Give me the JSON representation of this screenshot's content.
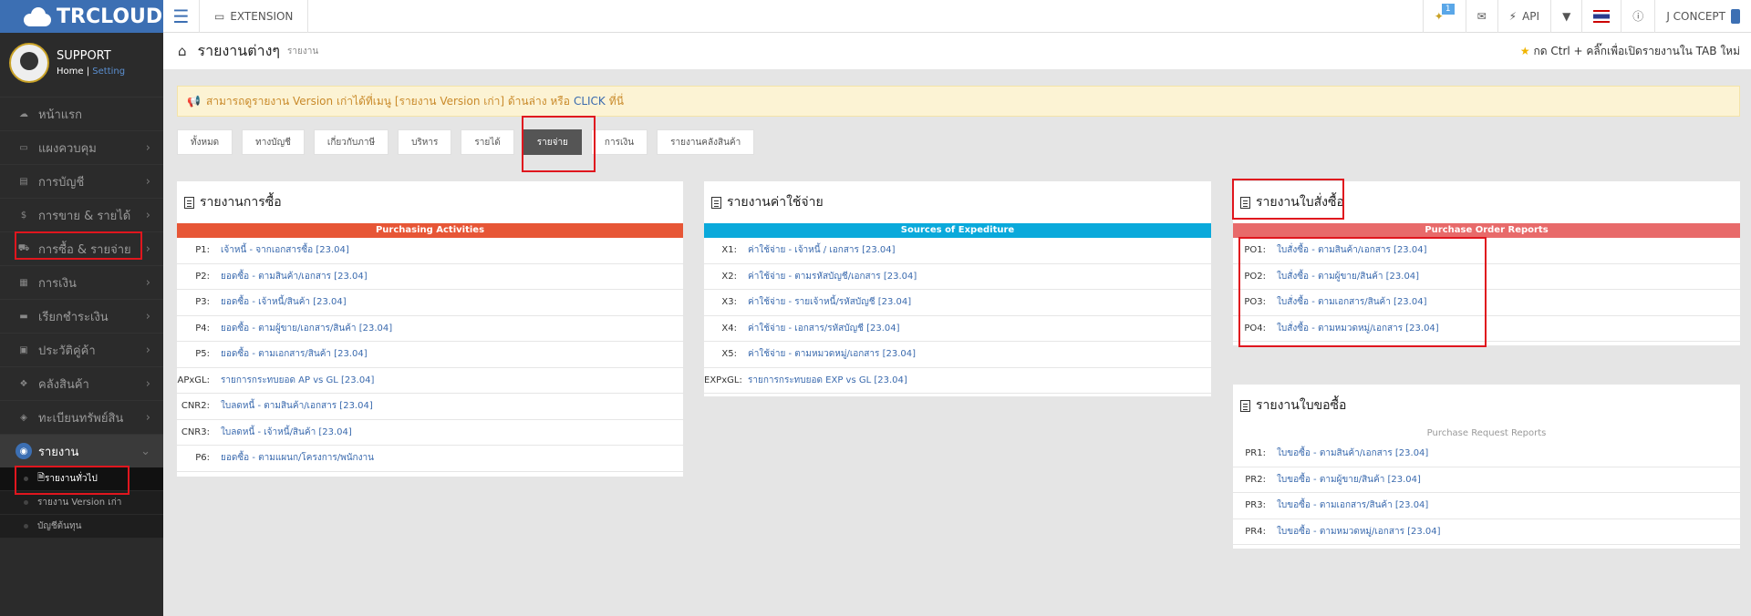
{
  "app": {
    "logo": "TRCLOUD"
  },
  "profile": {
    "name": "SUPPORT",
    "home": "Home",
    "sep": "|",
    "setting": "Setting"
  },
  "sidebar": {
    "items": [
      {
        "label": "หน้าแรก",
        "icon": "cloud-icon",
        "chev": ""
      },
      {
        "label": "แผงควบคุม",
        "icon": "monitor-icon",
        "chev": "›"
      },
      {
        "label": "การบัญชี",
        "icon": "book-icon",
        "chev": "›"
      },
      {
        "label": "การขาย & รายได้",
        "icon": "dollar-icon",
        "chev": "›"
      },
      {
        "label": "การซื้อ & รายจ่าย",
        "icon": "cart-icon",
        "chev": "›"
      },
      {
        "label": "การเงิน",
        "icon": "calendar-icon",
        "chev": "›"
      },
      {
        "label": "เรียกชำระเงิน",
        "icon": "card-icon",
        "chev": "›"
      },
      {
        "label": "ประวัติคู่ค้า",
        "icon": "contact-icon",
        "chev": "›"
      },
      {
        "label": "คลังสินค้า",
        "icon": "cubes-icon",
        "chev": "›"
      },
      {
        "label": "ทะเบียนทรัพย์สิน",
        "icon": "diamond-icon",
        "chev": "›"
      },
      {
        "label": "รายงาน",
        "icon": "report-icon",
        "chev": "⌄"
      }
    ],
    "sub": [
      "รายงานทั่วไป",
      "รายงาน Version เก่า",
      "บัญชีต้นทุน"
    ]
  },
  "topbar": {
    "extension": "EXTENSION",
    "badge": "1",
    "api": "API",
    "user": "J CONCEPT"
  },
  "crumb": {
    "title": "รายงานต่างๆ",
    "sub": "รายงาน",
    "hint": "กด Ctrl + คลิ๊กเพื่อเปิดรายงานใน TAB ใหม่"
  },
  "notice": {
    "pre": "สามารถดูรายงาน Version เก่าได้ที่เมนู [รายงาน Version เก่า] ด้านล่าง หรือ",
    "click": "CLICK",
    "post": "ที่นี่"
  },
  "tabs": [
    "ทั้งหมด",
    "ทางบัญชี",
    "เกี่ยวกับภาษี",
    "บริหาร",
    "รายได้",
    "รายจ่าย",
    "การเงิน",
    "รายงานคลังสินค้า"
  ],
  "colors": {
    "purchase": "#e75636",
    "expense": "#0aa9db",
    "po": "#e86a6a",
    "pr": "#ffffff"
  },
  "panels": {
    "purchase": {
      "title": "รายงานการซื้อ",
      "bar": "Purchasing Activities",
      "rows": [
        {
          "code": "P1:",
          "text": "เจ้าหนี้ - จากเอกสารซื้อ [23.04]"
        },
        {
          "code": "P2:",
          "text": "ยอดซื้อ - ตามสินค้า/เอกสาร [23.04]"
        },
        {
          "code": "P3:",
          "text": "ยอดซื้อ - เจ้าหนี้/สินค้า [23.04]"
        },
        {
          "code": "P4:",
          "text": "ยอดซื้อ - ตามผู้ขาย/เอกสาร/สินค้า [23.04]"
        },
        {
          "code": "P5:",
          "text": "ยอดซื้อ - ตามเอกสาร/สินค้า [23.04]"
        },
        {
          "code": "APxGL:",
          "text": "รายการกระทบยอด AP vs GL [23.04]"
        },
        {
          "code": "CNR2:",
          "text": "ใบลดหนี้ - ตามสินค้า/เอกสาร [23.04]"
        },
        {
          "code": "CNR3:",
          "text": "ใบลดหนี้ - เจ้าหนี้/สินค้า [23.04]"
        },
        {
          "code": "P6:",
          "text": "ยอดซื้อ - ตามแผนก/โครงการ/พนักงาน"
        }
      ]
    },
    "expense": {
      "title": "รายงานค่าใช้จ่าย",
      "bar": "Sources of Expediture",
      "rows": [
        {
          "code": "X1:",
          "text": "ค่าใช้จ่าย - เจ้าหนี้ / เอกสาร [23.04]"
        },
        {
          "code": "X2:",
          "text": "ค่าใช้จ่าย - ตามรหัสบัญชี/เอกสาร [23.04]"
        },
        {
          "code": "X3:",
          "text": "ค่าใช้จ่าย - รายเจ้าหนี้/รหัสบัญชี [23.04]"
        },
        {
          "code": "X4:",
          "text": "ค่าใช้จ่าย - เอกสาร/รหัสบัญชี [23.04]"
        },
        {
          "code": "X5:",
          "text": "ค่าใช้จ่าย - ตามหมวดหมู่/เอกสาร [23.04]"
        },
        {
          "code": "EXPxGL:",
          "text": "รายการกระทบยอด EXP vs GL [23.04]"
        }
      ]
    },
    "po": {
      "title": "รายงานใบสั่งซื้อ",
      "bar": "Purchase Order Reports",
      "rows": [
        {
          "code": "PO1:",
          "text": "ใบสั่งซื้อ - ตามสินค้า/เอกสาร [23.04]"
        },
        {
          "code": "PO2:",
          "text": "ใบสั่งซื้อ - ตามผู้ขาย/สินค้า [23.04]"
        },
        {
          "code": "PO3:",
          "text": "ใบสั่งซื้อ - ตามเอกสาร/สินค้า [23.04]"
        },
        {
          "code": "PO4:",
          "text": "ใบสั่งซื้อ - ตามหมวดหมู่/เอกสาร [23.04]"
        }
      ]
    },
    "pr": {
      "title": "รายงานใบขอซื้อ",
      "bar": "Purchase Request Reports",
      "rows": [
        {
          "code": "PR1:",
          "text": "ใบขอซื้อ - ตามสินค้า/เอกสาร [23.04]"
        },
        {
          "code": "PR2:",
          "text": "ใบขอซื้อ - ตามผู้ขาย/สินค้า [23.04]"
        },
        {
          "code": "PR3:",
          "text": "ใบขอซื้อ - ตามเอกสาร/สินค้า [23.04]"
        },
        {
          "code": "PR4:",
          "text": "ใบขอซื้อ - ตามหมวดหมู่/เอกสาร [23.04]"
        }
      ]
    }
  }
}
